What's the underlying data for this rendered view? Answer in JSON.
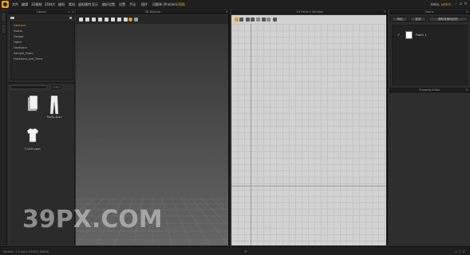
{
  "menubar": {
    "items": [
      {
        "label": "文件",
        "active": false
      },
      {
        "label": "编辑",
        "active": false
      },
      {
        "label": "3D服装",
        "active": false
      },
      {
        "label": "2D样片",
        "active": false
      },
      {
        "label": "缝纫",
        "active": false
      },
      {
        "label": "素材",
        "active": false
      },
      {
        "label": "虚拟模特",
        "active": false
      },
      {
        "label": "显示",
        "active": false
      },
      {
        "label": "偏好设置",
        "active": false
      },
      {
        "label": "设置",
        "active": false
      },
      {
        "label": "手动",
        "active": false
      },
      {
        "label": "插件",
        "active": false
      },
      {
        "label": "问题单 (Problem)",
        "active": false
      },
      {
        "label": "帮助",
        "active": true
      }
    ],
    "user": "Hello,",
    "user_badge": "admin"
  },
  "library": {
    "title": "Library",
    "tree": [
      "Garment",
      "Avatar",
      "Hanger",
      "Fabric",
      "Hardware",
      "Sample_Fabric",
      "Hardware_and_Trims"
    ],
    "items": [
      {
        "label": ""
      },
      {
        "label": "Pants.zpac"
      },
      {
        "label": "T-shirt.zpac"
      }
    ]
  },
  "view3d": {
    "title": "3D Window"
  },
  "view2d": {
    "title": "2D Pattern Window"
  },
  "fabric": {
    "title": "Fabric",
    "buttons": [
      "添加",
      "复制",
      "删除未使用过的"
    ],
    "items": [
      {
        "name": "Fabric 1"
      }
    ]
  },
  "property": {
    "title": "Property Editor"
  },
  "status": {
    "left": "Version: 7.1.xxx (r25301)  [64bit]",
    "center": "⊕",
    "right": "▭ ▢ ✕"
  },
  "watermark": "39PX.COM",
  "colors": {
    "accent": "#f4a300",
    "canvas": "#d2d2d2"
  }
}
